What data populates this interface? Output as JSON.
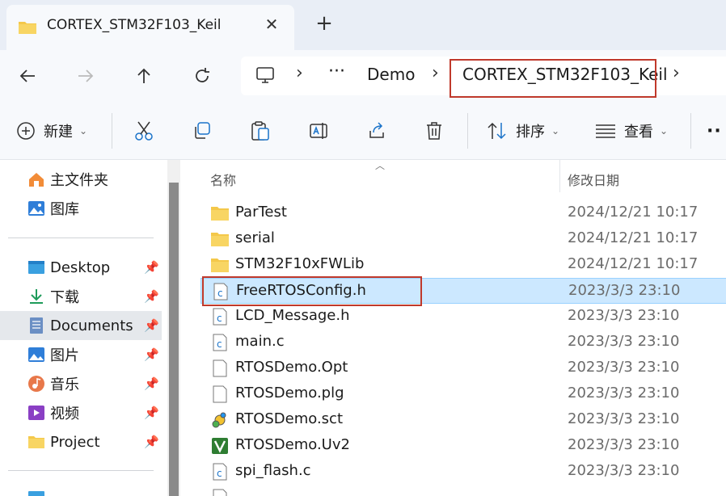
{
  "tab": {
    "title": "CORTEX_STM32F103_Keil",
    "close_icon": "close-icon",
    "new_tab_icon": "plus-icon"
  },
  "nav": {
    "back": "back-arrow-icon",
    "forward": "forward-arrow-icon",
    "up": "up-arrow-icon",
    "refresh": "refresh-icon"
  },
  "breadcrumb": {
    "more": "···",
    "items": [
      "Demo",
      "CORTEX_STM32F103_Keil"
    ],
    "separator": "›"
  },
  "toolbar": {
    "new_label": "新建",
    "sort_label": "排序",
    "view_label": "查看",
    "more": "··"
  },
  "sidebar": {
    "items": [
      {
        "label": "主文件夹",
        "icon": "home-icon",
        "pinned": false
      },
      {
        "label": "图库",
        "icon": "gallery-icon",
        "pinned": false
      },
      {
        "label": "Desktop",
        "icon": "desktop-icon",
        "pinned": true
      },
      {
        "label": "下载",
        "icon": "download-icon",
        "pinned": true
      },
      {
        "label": "Documents",
        "icon": "documents-icon",
        "pinned": true,
        "selected": true
      },
      {
        "label": "图片",
        "icon": "pictures-icon",
        "pinned": true
      },
      {
        "label": "音乐",
        "icon": "music-icon",
        "pinned": true
      },
      {
        "label": "视频",
        "icon": "video-icon",
        "pinned": true
      },
      {
        "label": "Project",
        "icon": "folder-icon",
        "pinned": true
      }
    ]
  },
  "list": {
    "columns": {
      "name": "名称",
      "modified": "修改日期"
    },
    "rows": [
      {
        "name": "ParTest",
        "date": "2024/12/21 10:17",
        "type": "folder"
      },
      {
        "name": "serial",
        "date": "2024/12/21 10:17",
        "type": "folder"
      },
      {
        "name": "STM32F10xFWLib",
        "date": "2024/12/21 10:17",
        "type": "folder"
      },
      {
        "name": "FreeRTOSConfig.h",
        "date": "2023/3/3 23:10",
        "type": "c-file",
        "selected": true
      },
      {
        "name": "LCD_Message.h",
        "date": "2023/3/3 23:10",
        "type": "c-file"
      },
      {
        "name": "main.c",
        "date": "2023/3/3 23:10",
        "type": "c-file"
      },
      {
        "name": "RTOSDemo.Opt",
        "date": "2023/3/3 23:10",
        "type": "blank-file"
      },
      {
        "name": "RTOSDemo.plg",
        "date": "2023/3/3 23:10",
        "type": "blank-file"
      },
      {
        "name": "RTOSDemo.sct",
        "date": "2023/3/3 23:10",
        "type": "sct-file"
      },
      {
        "name": "RTOSDemo.Uv2",
        "date": "2023/3/3 23:10",
        "type": "uv2-file"
      },
      {
        "name": "spi_flash.c",
        "date": "2023/3/3 23:10",
        "type": "c-file"
      }
    ]
  },
  "colors": {
    "highlight": "#c0392b",
    "selection": "#cce8ff",
    "folder": "#f4c84a"
  }
}
